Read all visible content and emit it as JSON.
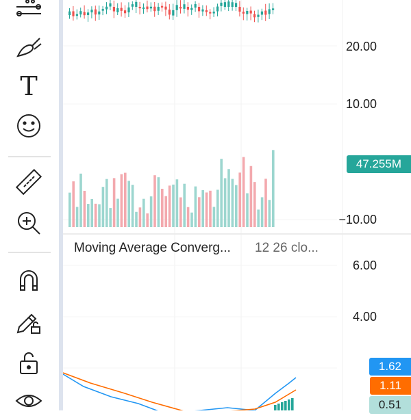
{
  "toolbar": {
    "tools": [
      {
        "icon": "fib-retracement-icon"
      },
      {
        "icon": "brush-icon"
      },
      {
        "icon": "text-tool-icon",
        "label": "T"
      },
      {
        "icon": "emoji-icon"
      },
      {
        "icon": "ruler-icon"
      },
      {
        "icon": "zoom-in-icon"
      },
      {
        "icon": "magnet-icon"
      },
      {
        "icon": "lock-drawings-icon"
      },
      {
        "icon": "unlock-icon"
      },
      {
        "icon": "eye-icon"
      }
    ]
  },
  "price_pane": {
    "price_labels": [
      "20.00",
      "10.00",
      "−10.00"
    ],
    "volume_tag": {
      "text": "47.255M",
      "color": "#26a69a"
    }
  },
  "macd_pane": {
    "title": "Moving Average Converg...",
    "params": "12 26 clo...",
    "labels": [
      "6.00",
      "4.00"
    ],
    "tags": [
      {
        "text": "1.62",
        "color": "#2196f3",
        "text_color": "#ffffff"
      },
      {
        "text": "1.11",
        "color": "#ff6d00",
        "text_color": "#ffffff"
      },
      {
        "text": "0.51",
        "color": "#b2dfdb",
        "text_color": "#1c1c1c"
      }
    ]
  },
  "colors": {
    "up": "#26a69a",
    "down": "#ef5350",
    "volume_up": "#9cd6cf",
    "volume_down": "#f3a9ae",
    "macd_line": "#2196f3",
    "signal_line": "#ff6d00"
  }
}
